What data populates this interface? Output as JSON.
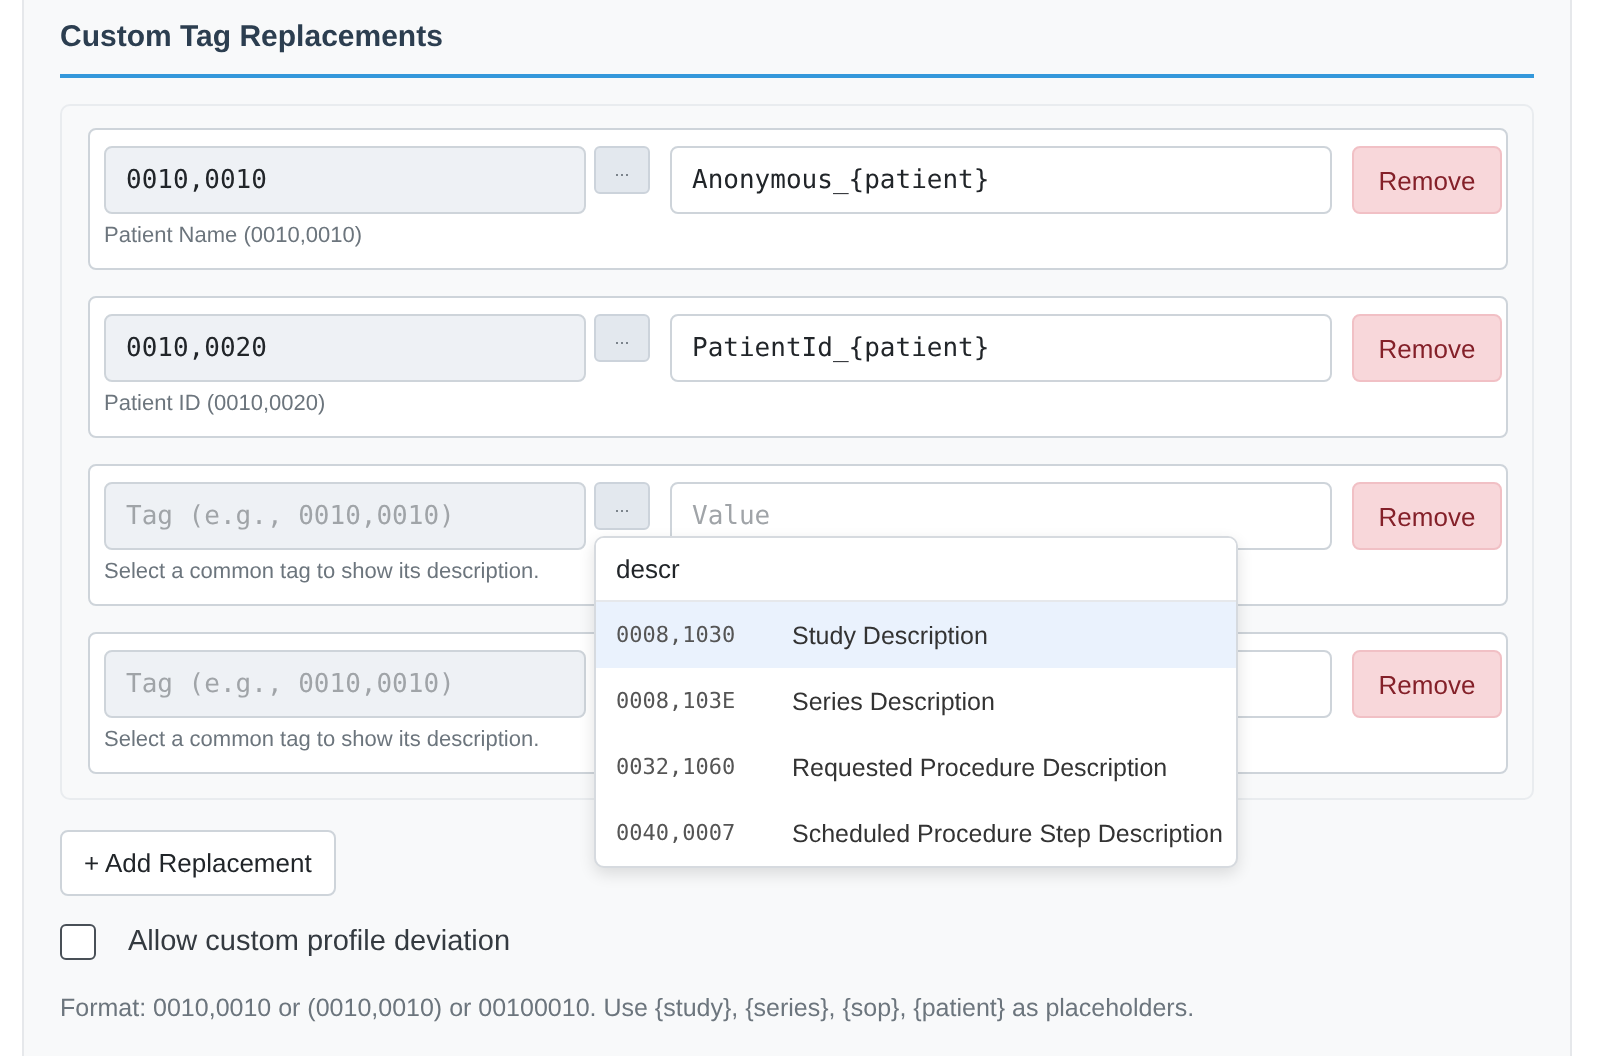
{
  "title": "Custom Tag Replacements",
  "rows": [
    {
      "tag": "0010,0010",
      "description": "Patient Name (0010,0010)",
      "picker_button": "...",
      "value": "Anonymous_{patient}",
      "remove": "Remove"
    },
    {
      "tag": "0010,0020",
      "description": "Patient ID (0010,0020)",
      "picker_button": "...",
      "value": "PatientId_{patient}",
      "remove": "Remove"
    },
    {
      "tag_placeholder": "Tag (e.g., 0010,0010)",
      "description": "Select a common tag to show its description.",
      "picker_button": "...",
      "value_placeholder": "Value",
      "remove": "Remove",
      "picker": {
        "query": "descr",
        "options": [
          {
            "tag": "0008,1030",
            "name": "Study Description",
            "selected": true
          },
          {
            "tag": "0008,103E",
            "name": "Series Description",
            "selected": false
          },
          {
            "tag": "0032,1060",
            "name": "Requested Procedure Description",
            "selected": false
          },
          {
            "tag": "0040,0007",
            "name": "Scheduled Procedure Step Description",
            "selected": false
          }
        ]
      }
    },
    {
      "tag_placeholder": "Tag (e.g., 0010,0010)",
      "description": "Select a common tag to show its description.",
      "remove": "Remove"
    }
  ],
  "add_button": "+ Add Replacement",
  "allow_deviation": {
    "label": "Allow custom profile deviation",
    "checked": false
  },
  "help": "Format: 0010,0010 or (0010,0010) or 00100010. Use {study}, {series}, {sop}, {patient} as placeholders."
}
